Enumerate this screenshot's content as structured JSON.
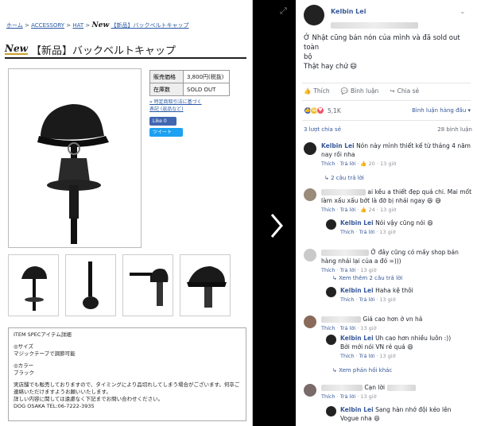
{
  "shop": {
    "breadcrumb": [
      "ホーム",
      "ACCESSORY",
      "HAT"
    ],
    "breadcrumb_current": "【新品】バックベルトキャップ",
    "new_badge": "New",
    "title": "【新品】バックベルトキャップ",
    "spec_rows": [
      {
        "key": "販売価格",
        "value": "3,800円(税抜)"
      },
      {
        "key": "在庫数",
        "value": "SOLD OUT"
      }
    ],
    "links": [
      "» 特定商取引法に基づく",
      "表記 (返品など)"
    ],
    "like_label": "Like 0",
    "tweet_label": "ツイート",
    "item_spec": {
      "heading": "ITEM SPECアイテム詳細",
      "size_label": "◎サイズ",
      "size_text": "マジックテープで調節可能",
      "color_label": "◎カラー",
      "color_text": "ブラック",
      "notice_lines": [
        "実店舗でも販売しておりますので、タイミングにより品切れしてしまう場合がございます。何卒ご",
        "連絡いただけますようお願いいたします。",
        "詳しい内容に関しては遠慮なく下記までお問い合わせください。"
      ],
      "contact": "DOG OSAKA TEL:06-7222-3935"
    }
  },
  "fb": {
    "author": "Kelbin Lei",
    "post_text_lines": [
      "Ở Nhật cũng bán nón của mình và đã sold out toàn",
      "bộ",
      "Thật hay chứ 😄"
    ],
    "actions": {
      "like": "Thích",
      "comment": "Bình luận",
      "share": "Chia sẻ"
    },
    "reaction_count": "5,1K",
    "sort_label": "Bình luận hàng đầu ▾",
    "shares": "3 lượt chia sẻ",
    "comments_count": "28 bình luận",
    "comments": [
      {
        "name": "Kelbin Lei",
        "text": "Nón này mình thiết kế từ tháng 4 năm nay rồi nha",
        "like": "Thích",
        "reply": "Trả lời",
        "likes": "20",
        "time": "13 giờ"
      },
      {
        "name": "",
        "text": "ai kêu a thiết đẹp quá chi. Mai mốt làm xấu xấu bớt là đỡ bị nhái ngay 😆 😅",
        "like": "Thích",
        "reply": "Trả lời",
        "likes": "24",
        "time": "13 giờ"
      },
      {
        "name": "",
        "text": "Ở đây cũng có mấy shop bán hàng nhái lại của a đó =)))",
        "like": "Thích",
        "reply": "Trả lời",
        "likes": "",
        "time": "13 giờ"
      },
      {
        "name": "",
        "text": "Giá cao hơn ở vn hả",
        "like": "Thích",
        "reply": "Trả lời",
        "likes": "",
        "time": "13 giờ"
      },
      {
        "name": "",
        "text": "Cạn lời",
        "like": "Thích",
        "reply": "Trả lời",
        "likes": "",
        "time": "13 giờ"
      }
    ],
    "replies": [
      {
        "name": "Kelbin Lei",
        "text": "Nói vậy cũng nói 😄",
        "like": "Thích",
        "reply": "Trả lời",
        "likes": "",
        "time": "13 giờ"
      },
      {
        "name": "Kelbin Lei",
        "text": "Haha kệ thôi",
        "like": "Thích",
        "reply": "Trả lời",
        "likes": "",
        "time": "13 giờ"
      },
      {
        "name": "Kelbin Lei",
        "text": "Uh cao hơn nhiều luôn :))",
        "text2": "Bởi mới nói VN rẻ quá 😄",
        "like": "Thích",
        "reply": "Trả lời",
        "likes": "",
        "time": "13 giờ"
      },
      {
        "name": "Kelbin Lei",
        "text": "Sang hàn nhớ đội kẻo lên",
        "text2": "Vogue nha 😄",
        "like": "",
        "reply": "",
        "likes": "",
        "time": ""
      }
    ],
    "reply_links": [
      "↳ 2 câu trả lời",
      "↳ Xem thêm 2 câu trả lời",
      "↳ Xem phản hồi khác"
    ]
  }
}
